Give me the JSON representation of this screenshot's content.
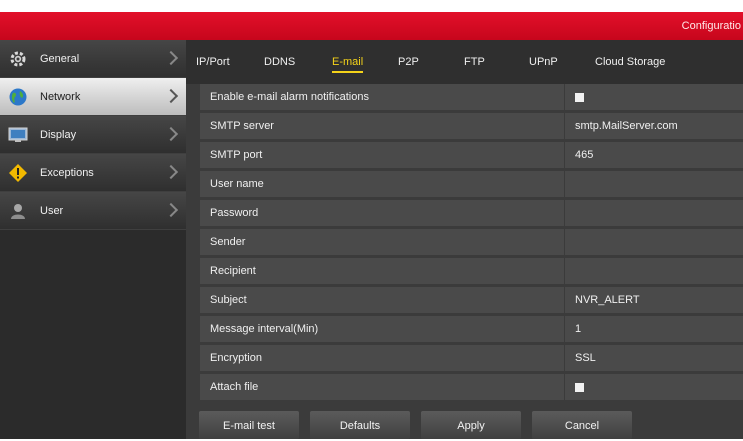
{
  "header": {
    "title": "Configuratio"
  },
  "sidebar": {
    "items": [
      {
        "label": "General",
        "icon": "gear-icon"
      },
      {
        "label": "Network",
        "icon": "globe-icon"
      },
      {
        "label": "Display",
        "icon": "monitor-icon"
      },
      {
        "label": "Exceptions",
        "icon": "warning-icon"
      },
      {
        "label": "User",
        "icon": "user-icon"
      }
    ],
    "active": "Network"
  },
  "tabs": {
    "items": [
      "IP/Port",
      "DDNS",
      "E-mail",
      "P2P",
      "FTP",
      "UPnP",
      "Cloud Storage"
    ],
    "active": "E-mail"
  },
  "form": {
    "rows": [
      {
        "label": "Enable e-mail alarm notifications",
        "value": "",
        "checkbox": true
      },
      {
        "label": "SMTP server",
        "value": "smtp.MailServer.com"
      },
      {
        "label": "SMTP port",
        "value": "465"
      },
      {
        "label": "User name",
        "value": ""
      },
      {
        "label": "Password",
        "value": ""
      },
      {
        "label": "Sender",
        "value": ""
      },
      {
        "label": "Recipient",
        "value": ""
      },
      {
        "label": "Subject",
        "value": "NVR_ALERT"
      },
      {
        "label": "Message interval(Min)",
        "value": "1"
      },
      {
        "label": "Encryption",
        "value": "SSL"
      },
      {
        "label": "Attach file",
        "value": "",
        "checkbox": true
      }
    ]
  },
  "buttons": {
    "email_test": "E-mail test",
    "defaults": "Defaults",
    "apply": "Apply",
    "cancel": "Cancel"
  },
  "colors": {
    "header_red": "#d40a22",
    "tab_active": "#f4d31a",
    "panel_bg": "#3b3b3b",
    "row_bg": "#4a4a4a"
  }
}
